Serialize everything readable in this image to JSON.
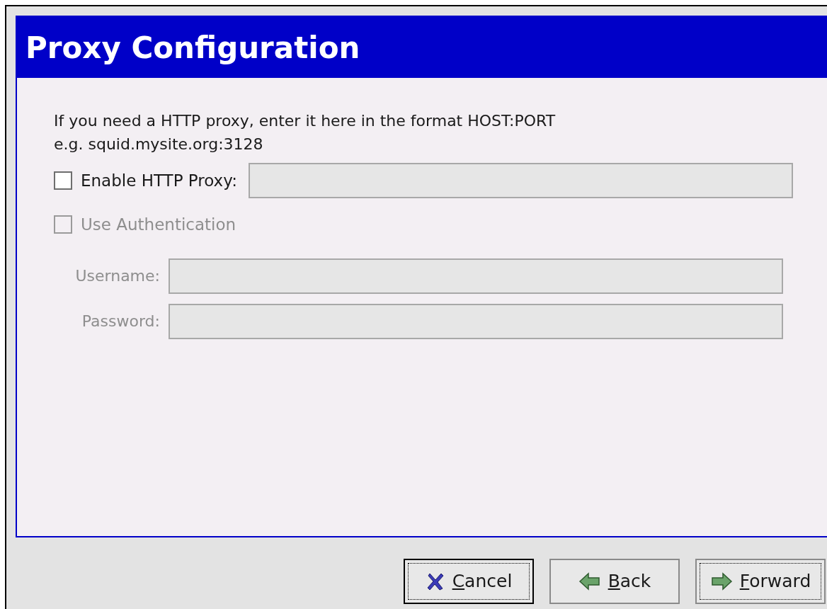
{
  "header": {
    "title": "Proxy Configuration"
  },
  "intro": [
    "If you need a HTTP proxy, enter it here in the format HOST:PORT",
    "e.g. squid.mysite.org:3128"
  ],
  "proxy": {
    "label": "Enable HTTP Proxy:",
    "checked": false,
    "disabled": false
  },
  "auth": {
    "label": "Use Authentication",
    "checked": false,
    "disabled": true
  },
  "fields": [
    {
      "label": "Username:",
      "disabled": true
    },
    {
      "label": "Password:",
      "disabled": true
    }
  ],
  "buttons": [
    {
      "kind": "cancel",
      "label": "Cancel",
      "underline_first": true,
      "default": true,
      "focused": true
    },
    {
      "kind": "back",
      "label": "Back",
      "underline_first": true,
      "default": false,
      "focused": false
    },
    {
      "kind": "forward",
      "label": "Forward",
      "underline_first": true,
      "default": false,
      "focused": true
    }
  ]
}
